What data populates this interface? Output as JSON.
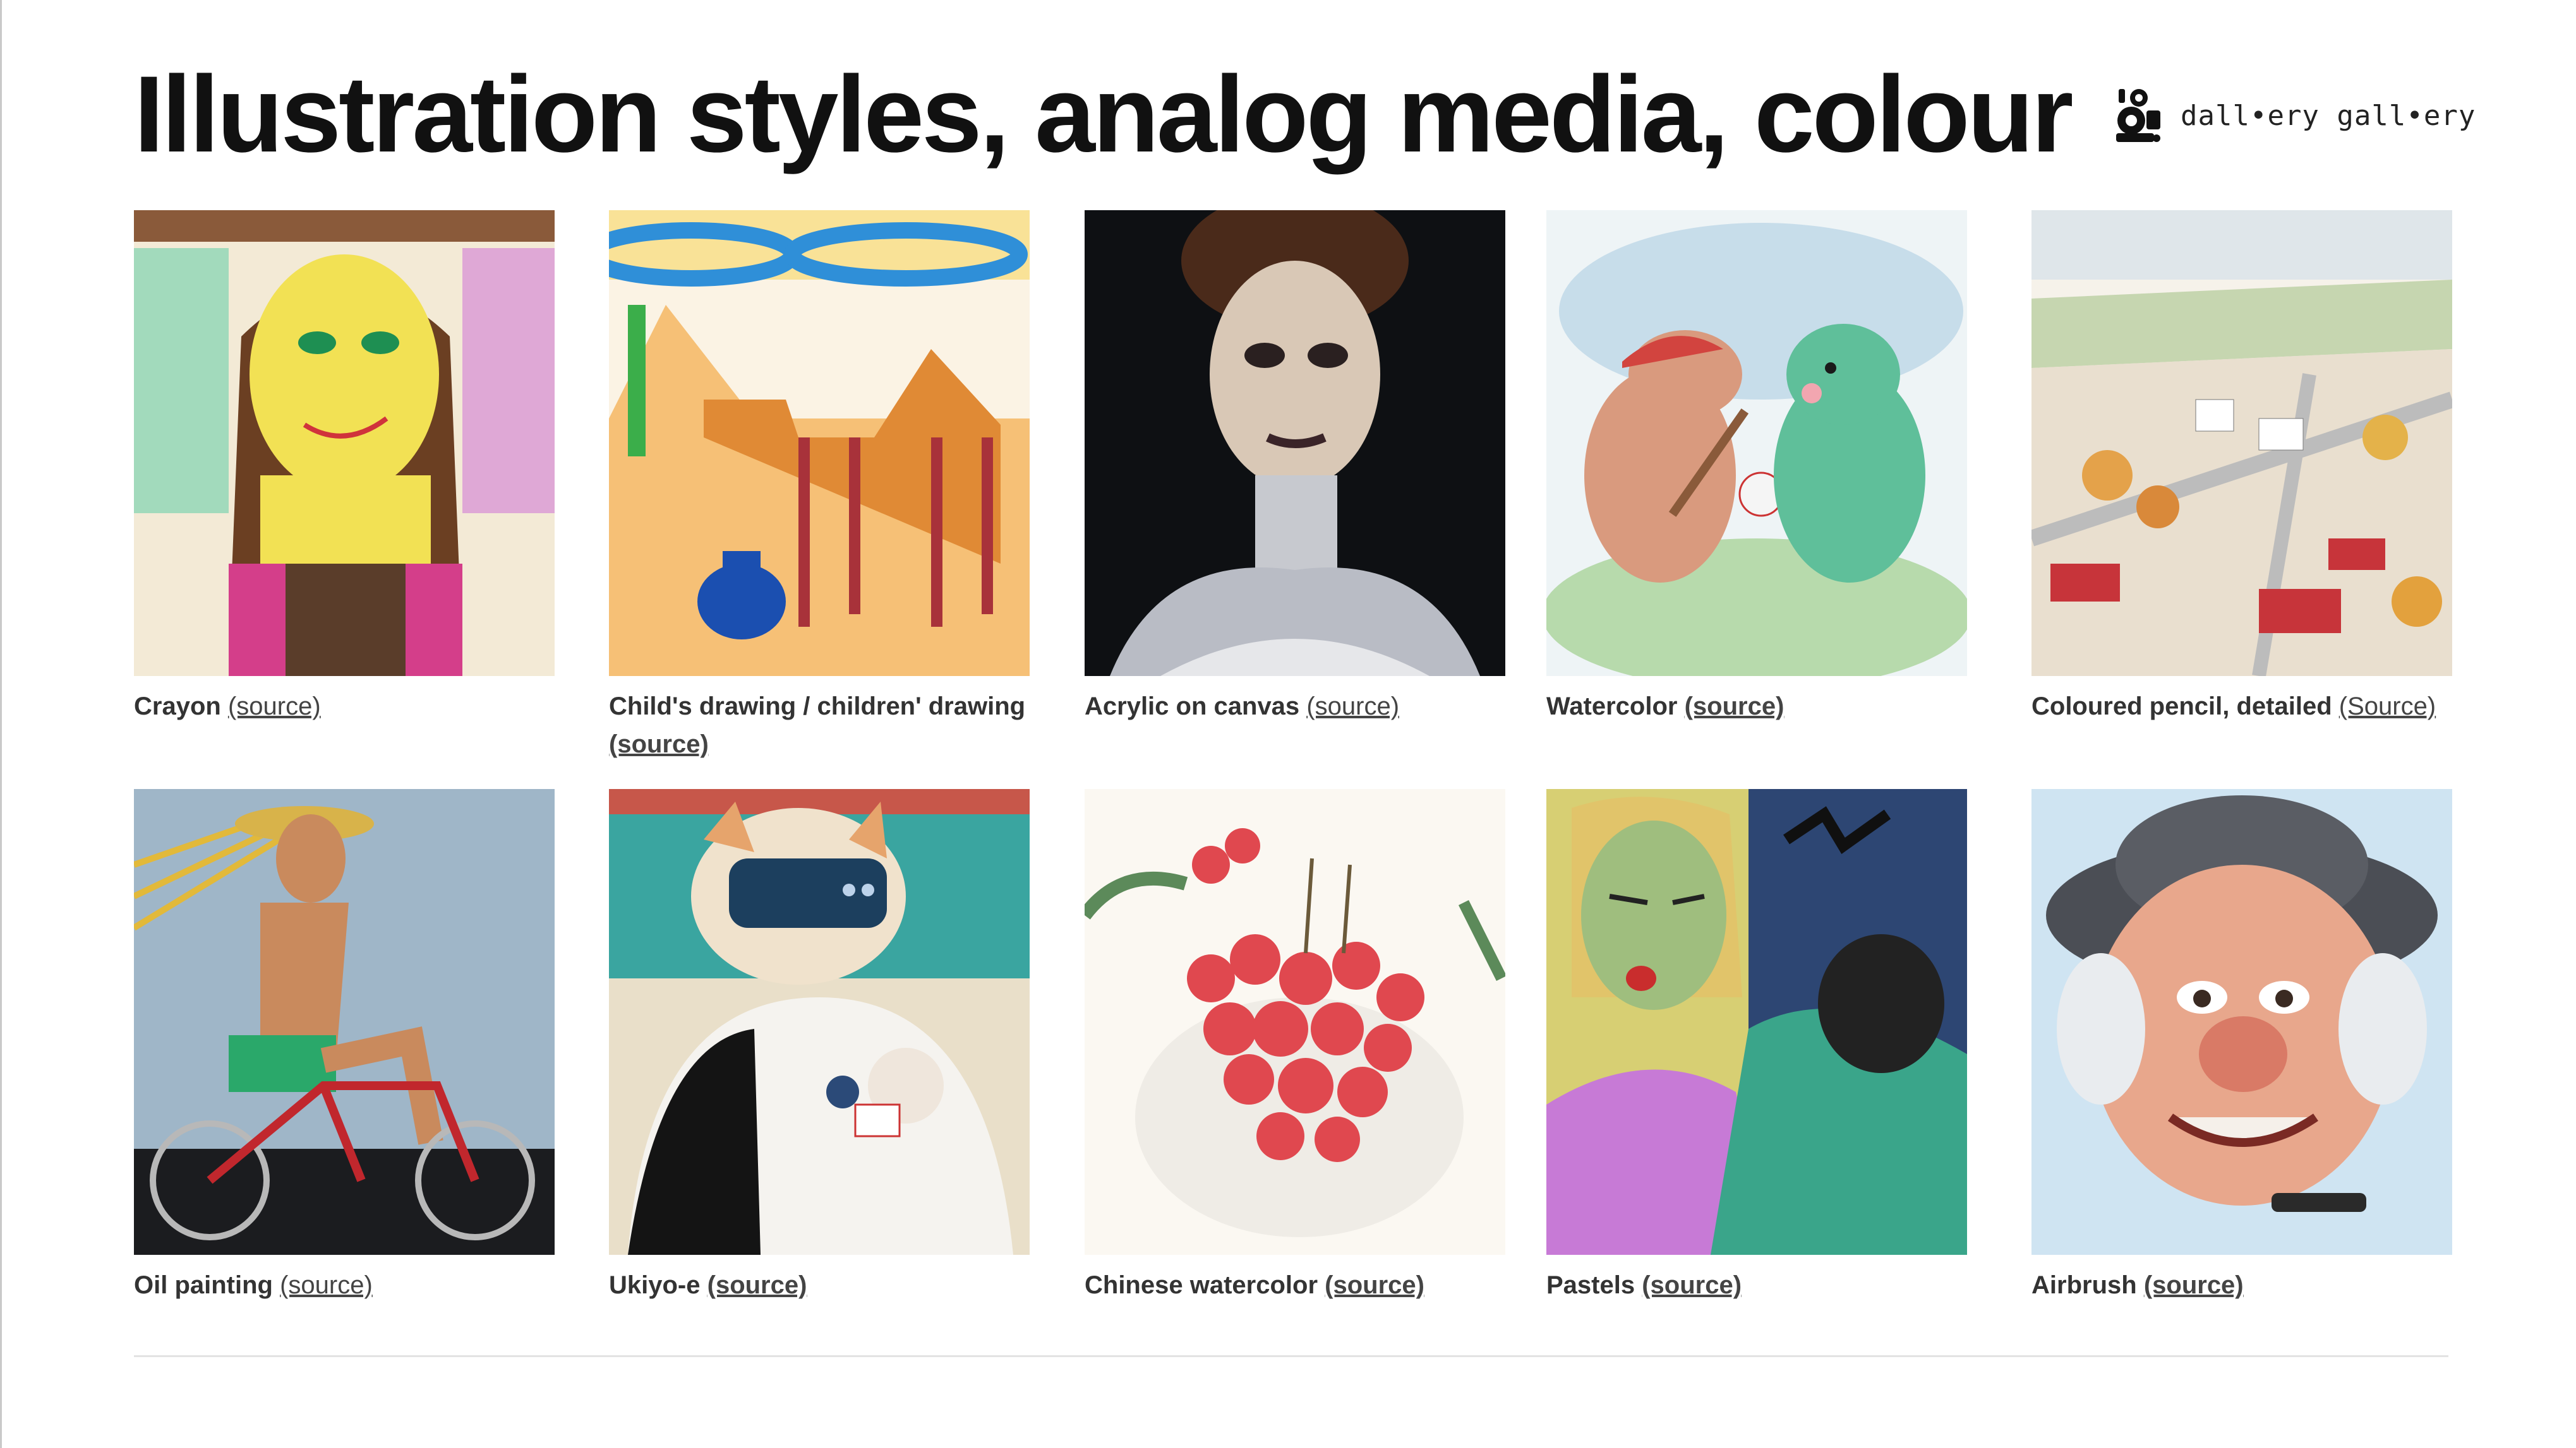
{
  "page": {
    "title": "Illustration styles, analog media, colour",
    "brand": "dall•ery gall•ery"
  },
  "tiles": [
    {
      "caption": "Crayon",
      "link": "(source)",
      "icon": "crayon-portrait-image"
    },
    {
      "caption": "Child's drawing / children' drawing",
      "link": "(source)",
      "icon": "childs-drawing-camel-image"
    },
    {
      "caption": "Acrylic on canvas",
      "link": "(source)",
      "icon": "acrylic-portrait-image"
    },
    {
      "caption": "Watercolor",
      "link": "(source)",
      "icon": "watercolor-dinosaurs-image"
    },
    {
      "caption": "Coloured pencil, detailed",
      "link": "(Source)",
      "icon": "coloured-pencil-village-image"
    },
    {
      "caption": "Oil painting",
      "link": "(source)",
      "icon": "oil-painting-cyclist-image"
    },
    {
      "caption": "Ukiyo-e",
      "link": "(source)",
      "icon": "ukiyo-e-cat-image"
    },
    {
      "caption": "Chinese watercolor",
      "link": "(source)",
      "icon": "chinese-watercolor-lychee-image"
    },
    {
      "caption": "Pastels",
      "link": "(source)",
      "icon": "pastels-portrait-image"
    },
    {
      "caption": "Airbrush",
      "link": "(source)",
      "icon": "airbrush-caricature-image"
    }
  ],
  "colors": {
    "title": "#111111",
    "caption": "#333333",
    "rule": "#e3e3e3"
  }
}
